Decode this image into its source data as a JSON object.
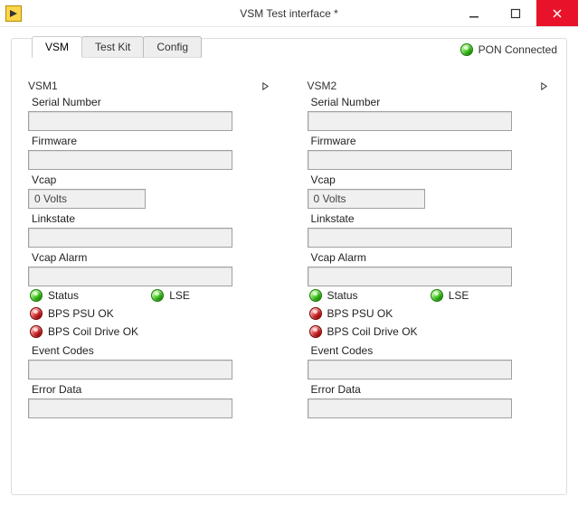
{
  "window": {
    "title": "VSM Test interface *"
  },
  "tabs": {
    "t0": "VSM",
    "t1": "Test Kit",
    "t2": "Config",
    "activeIndex": 0
  },
  "pon": {
    "label": "PON Connected"
  },
  "panels": {
    "vsm1": {
      "title": "VSM1",
      "serial_label": "Serial Number",
      "serial_value": "",
      "firmware_label": "Firmware",
      "firmware_value": "",
      "vcap_label": "Vcap",
      "vcap_value": "0 Volts",
      "linkstate_label": "Linkstate",
      "linkstate_value": "",
      "vcapalarm_label": "Vcap Alarm",
      "vcapalarm_value": "",
      "ind_status": "Status",
      "ind_lse": "LSE",
      "ind_bpspsu": "BPS PSU OK",
      "ind_bpscoil": "BPS Coil Drive OK",
      "eventcodes_label": "Event Codes",
      "eventcodes_value": "",
      "errordata_label": "Error Data",
      "errordata_value": ""
    },
    "vsm2": {
      "title": "VSM2",
      "serial_label": "Serial Number",
      "serial_value": "",
      "firmware_label": "Firmware",
      "firmware_value": "",
      "vcap_label": "Vcap",
      "vcap_value": "0 Volts",
      "linkstate_label": "Linkstate",
      "linkstate_value": "",
      "vcapalarm_label": "Vcap Alarm",
      "vcapalarm_value": "",
      "ind_status": "Status",
      "ind_lse": "LSE",
      "ind_bpspsu": "BPS PSU OK",
      "ind_bpscoil": "BPS Coil Drive OK",
      "eventcodes_label": "Event Codes",
      "eventcodes_value": "",
      "errordata_label": "Error Data",
      "errordata_value": ""
    }
  },
  "icons": {
    "minimize": "minimize-icon",
    "maximize": "maximize-icon",
    "close": "close-icon",
    "app": "app-icon",
    "chevron": "right-chevron-icon"
  },
  "colors": {
    "close_bg": "#e8132b",
    "led_green": "#17b000",
    "led_red": "#c40000",
    "field_bg": "#f0f0f0"
  }
}
